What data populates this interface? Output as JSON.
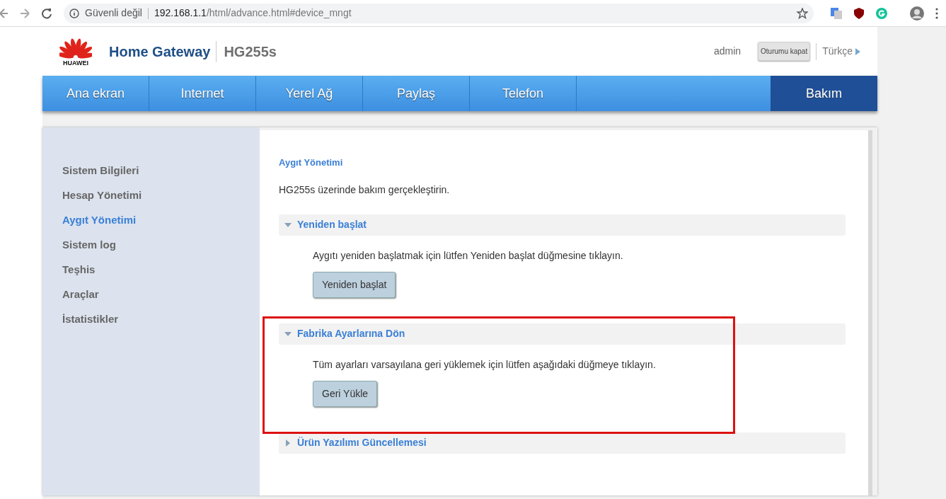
{
  "browser": {
    "security_label": "Güvenli değil",
    "url_host": "192.168.1.1",
    "url_path": "/html/advance.html#device_mngt"
  },
  "header": {
    "brand": "HUAWEI",
    "title": "Home Gateway",
    "model": "HG255s",
    "user": "admin",
    "logout": "Oturumu kapat",
    "language": "Türkçe"
  },
  "nav": [
    {
      "label": "Ana ekran",
      "selected": false
    },
    {
      "label": "Internet",
      "selected": false
    },
    {
      "label": "Yerel Ağ",
      "selected": false
    },
    {
      "label": "Paylaş",
      "selected": false
    },
    {
      "label": "Telefon",
      "selected": false
    },
    {
      "label": "Bakım",
      "selected": true
    }
  ],
  "sidebar": [
    {
      "label": "Sistem Bilgileri",
      "selected": false
    },
    {
      "label": "Hesap Yönetimi",
      "selected": false
    },
    {
      "label": "Aygıt Yönetimi",
      "selected": true
    },
    {
      "label": "Sistem log",
      "selected": false
    },
    {
      "label": "Teşhis",
      "selected": false
    },
    {
      "label": "Araçlar",
      "selected": false
    },
    {
      "label": "İstatistikler",
      "selected": false
    }
  ],
  "content": {
    "title": "Aygıt Yönetimi",
    "description": "HG255s üzerinde bakım gerçekleştirin.",
    "sections": [
      {
        "title": "Yeniden başlat",
        "expanded": true,
        "highlighted": false,
        "text": "Aygıtı yeniden başlatmak için lütfen Yeniden başlat düğmesine tıklayın.",
        "button": "Yeniden başlat"
      },
      {
        "title": "Fabrika Ayarlarına Dön",
        "expanded": true,
        "highlighted": true,
        "text": "Tüm ayarları varsayılana geri yüklemek için lütfen aşağıdaki düğmeye tıklayın.",
        "button": "Geri Yükle"
      },
      {
        "title": "Ürün Yazılımı Güncellemesi",
        "expanded": false,
        "highlighted": false
      }
    ]
  }
}
